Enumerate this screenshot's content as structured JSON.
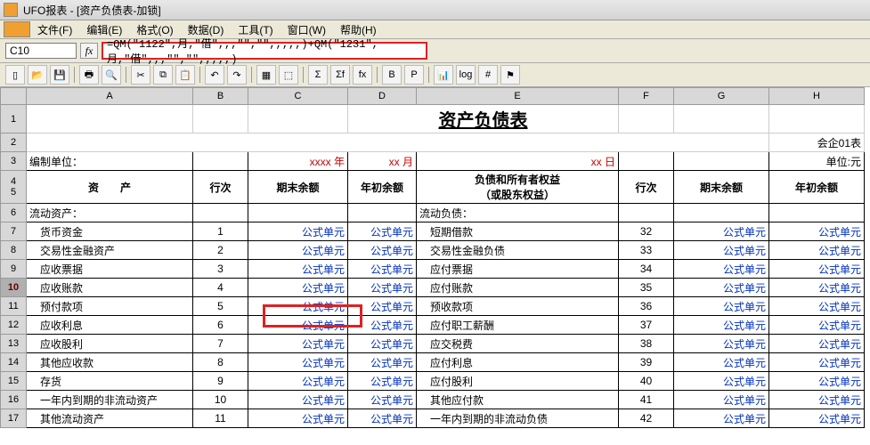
{
  "title": "UFO报表 - [资产负债表-加锁]",
  "menu": {
    "file": "文件(F)",
    "edit": "编辑(E)",
    "format": "格式(O)",
    "data": "数据(D)",
    "tool": "工具(T)",
    "window": "窗口(W)",
    "help": "帮助(H)"
  },
  "formula": {
    "ref": "C10",
    "value": "=QM(\"1122\",月,\"借\",,,\"\",\"\",,,,,)+QM(\"1231\",月,\"借\",,,\"\",\"\",,,,,)"
  },
  "toolbar_icons": [
    "new",
    "open",
    "save",
    "sep",
    "print",
    "preview",
    "sep",
    "cut",
    "copy",
    "paste",
    "sep",
    "undo",
    "redo",
    "sep",
    "border",
    "merge",
    "sep",
    "sum",
    "sigma",
    "func",
    "sep",
    "bold",
    "p",
    "sep",
    "chart",
    "log",
    "hash",
    "flag"
  ],
  "cols": [
    "",
    "A",
    "B",
    "C",
    "D",
    "E",
    "F",
    "G",
    "H"
  ],
  "sheet": {
    "title_big": "资产负债表",
    "top_right": "会企01表",
    "prep_label": "编制单位：",
    "year_lbl": "xxxx  年",
    "month_lbl": "xx  月",
    "day_lbl": "xx  日",
    "unit_lbl": "单位:元",
    "hdr_asset": "资　　产",
    "hdr_row": "行次",
    "hdr_end": "期末余额",
    "hdr_begin": "年初余额",
    "hdr_liab1": "负债和所有者权益",
    "hdr_liab2": "（或股东权益）",
    "sec_left": "流动资产：",
    "sec_right": "流动负债：",
    "link_txt": "公式单元",
    "left_rows": [
      {
        "n": "货币资金",
        "i": "1"
      },
      {
        "n": "交易性金融资产",
        "i": "2"
      },
      {
        "n": "应收票据",
        "i": "3"
      },
      {
        "n": "应收账款",
        "i": "4"
      },
      {
        "n": "预付款项",
        "i": "5"
      },
      {
        "n": "应收利息",
        "i": "6"
      },
      {
        "n": "应收股利",
        "i": "7"
      },
      {
        "n": "其他应收款",
        "i": "8"
      },
      {
        "n": "存货",
        "i": "9"
      },
      {
        "n": "一年内到期的非流动资产",
        "i": "10"
      },
      {
        "n": "其他流动资产",
        "i": "11"
      }
    ],
    "right_rows": [
      {
        "n": "短期借款",
        "i": "32"
      },
      {
        "n": "交易性金融负债",
        "i": "33"
      },
      {
        "n": "应付票据",
        "i": "34"
      },
      {
        "n": "应付账款",
        "i": "35"
      },
      {
        "n": "预收款项",
        "i": "36"
      },
      {
        "n": "应付职工薪酬",
        "i": "37"
      },
      {
        "n": "应交税费",
        "i": "38"
      },
      {
        "n": "应付利息",
        "i": "39"
      },
      {
        "n": "应付股利",
        "i": "40"
      },
      {
        "n": "其他应付款",
        "i": "41"
      },
      {
        "n": "一年内到期的非流动负债",
        "i": "42"
      }
    ]
  }
}
